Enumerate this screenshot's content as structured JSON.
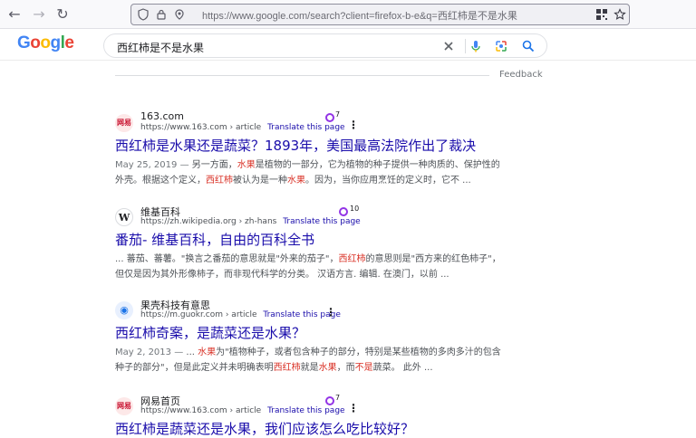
{
  "browser": {
    "url": "https://www.google.com/search?client=firefox-b-e&q=西红柿是不是水果"
  },
  "search": {
    "query": "西红柿是不是水果"
  },
  "feedback_label": "Feedback",
  "results": [
    {
      "site": "163.com",
      "cite": "https://www.163.com › article",
      "translate": "Translate this page",
      "badge_count": "7",
      "title": "西红柿是水果还是蔬菜？1893年，美国最高法院作出了裁决",
      "snippet": [
        {
          "t": "May 25, 2019 — ",
          "c": "date"
        },
        {
          "t": "另一方面，",
          "c": ""
        },
        {
          "t": "水果",
          "c": "hl"
        },
        {
          "t": "是植物的一部分，它为植物的种子提供一种肉质的、保护性的外壳。根据这个定义，",
          "c": ""
        },
        {
          "t": "西红柿",
          "c": "hl"
        },
        {
          "t": "被认为是一种",
          "c": ""
        },
        {
          "t": "水果",
          "c": "hl"
        },
        {
          "t": "。因为，当你应用烹饪的定义时，它不 ...",
          "c": ""
        }
      ]
    },
    {
      "site": "维基百科",
      "cite": "https://zh.wikipedia.org › zh-hans",
      "translate": "Translate this page",
      "badge_count": "10",
      "title": "番茄- 维基百科，自由的百科全书",
      "snippet": [
        {
          "t": "... 蕃茄、蕃薯。\"换言之番茄的意思就是\"外来的茄子\"，",
          "c": ""
        },
        {
          "t": "西红柿",
          "c": "hl"
        },
        {
          "t": "的意思则是\"西方来的红色柿子\"，但仅是因为其外形像柿子，而非现代科学的分类。 汉语方言. 编辑. 在澳门，以前 ...",
          "c": ""
        }
      ]
    },
    {
      "site": "果壳科技有意思",
      "cite": "https://m.guokr.com › article",
      "translate": "Translate this page",
      "badge_count": "",
      "title": "西红柿奇案，是蔬菜还是水果？",
      "snippet": [
        {
          "t": "May 2, 2013 — ",
          "c": "date"
        },
        {
          "t": "... ",
          "c": ""
        },
        {
          "t": "水果",
          "c": "hl"
        },
        {
          "t": "为\"植物种子，或者包含种子的部分，特别是某些植物的多肉多汁的包含种子的部分\"，但是此定义并未明确表明",
          "c": ""
        },
        {
          "t": "西红柿",
          "c": "hl"
        },
        {
          "t": "就是",
          "c": ""
        },
        {
          "t": "水果",
          "c": "hl"
        },
        {
          "t": "，而",
          "c": ""
        },
        {
          "t": "不是",
          "c": "hl"
        },
        {
          "t": "蔬菜。 此外 ...",
          "c": ""
        }
      ]
    },
    {
      "site": "网易首页",
      "cite": "https://www.163.com › article",
      "translate": "Translate this page",
      "badge_count": "7",
      "title": "西红柿是蔬菜还是水果，我们应该怎么吃比较好？",
      "snippet": []
    }
  ]
}
